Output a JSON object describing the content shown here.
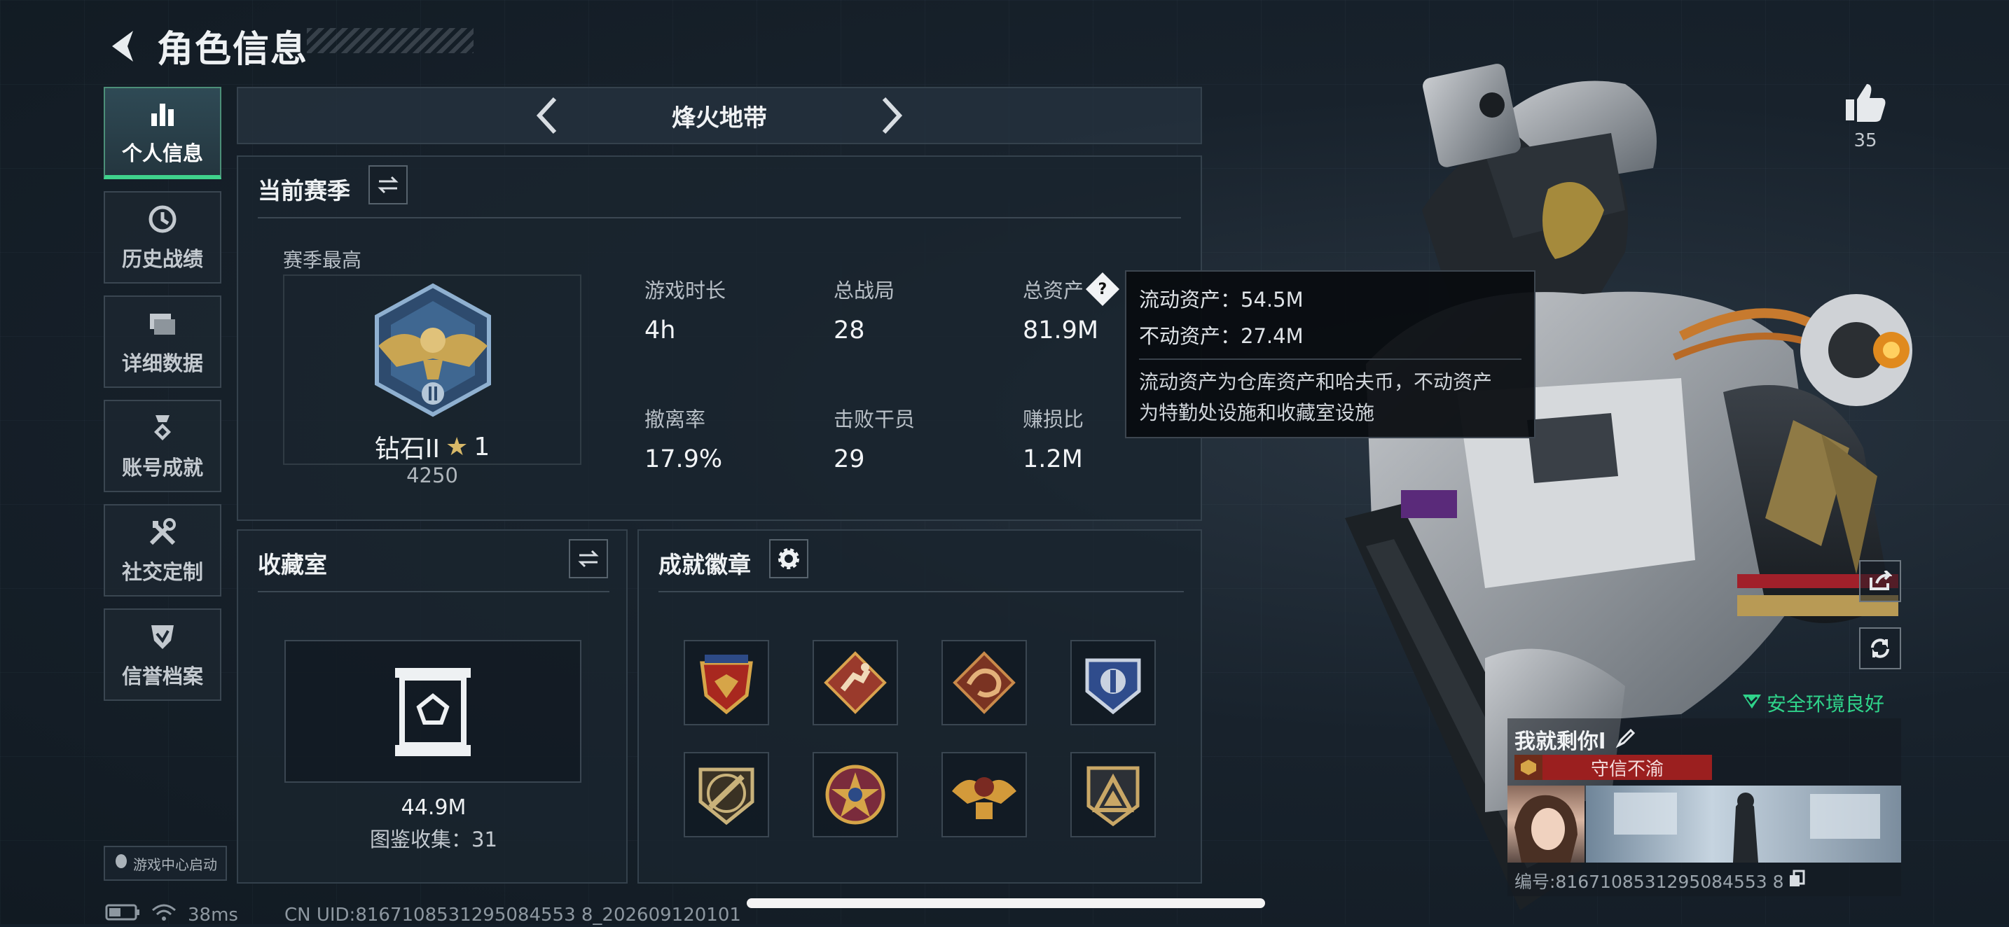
{
  "header": {
    "title": "角色信息"
  },
  "sidebar": {
    "items": [
      {
        "label": "个人信息",
        "icon": "bar-chart-icon",
        "active": true
      },
      {
        "label": "历史战绩",
        "icon": "clock-history-icon",
        "active": false
      },
      {
        "label": "详细数据",
        "icon": "folder-stack-icon",
        "active": false
      },
      {
        "label": "账号成就",
        "icon": "medal-icon",
        "active": false
      },
      {
        "label": "社交定制",
        "icon": "tools-icon",
        "active": false
      },
      {
        "label": "信誉档案",
        "icon": "shield-check-icon",
        "active": false
      }
    ]
  },
  "mode_selector": {
    "title": "烽火地带"
  },
  "season": {
    "title": "当前赛季",
    "best_label": "赛季最高",
    "rank_name": "钻石II",
    "rank_stars": "1",
    "rank_points": "4250",
    "stats": [
      {
        "label": "游戏时长",
        "value": "4h"
      },
      {
        "label": "总战局",
        "value": "28"
      },
      {
        "label": "总资产",
        "value": "81.9M"
      },
      {
        "label": "撤离率",
        "value": "17.9%"
      },
      {
        "label": "击败干员",
        "value": "29"
      },
      {
        "label": "赚损比",
        "value": "1.2M"
      }
    ]
  },
  "tooltip": {
    "liquid": "流动资产：54.5M",
    "fixed": "不动资产：27.4M",
    "desc_line1": "流动资产为仓库资产和哈夫币，不动资产",
    "desc_line2": "为特勤处设施和收藏室设施"
  },
  "collection": {
    "title": "收藏室",
    "value": "44.9M",
    "count_text": "图鉴收集：31"
  },
  "achievements": {
    "title": "成就徽章",
    "badges": [
      "shield-wings-badge",
      "running-figure-badge",
      "dragon-badge",
      "blue-emblem-badge",
      "rifle-badge",
      "star-medal-badge",
      "eagle-badge",
      "triangle-badge"
    ]
  },
  "likes": {
    "count": "35"
  },
  "security": {
    "text": "安全环境良好",
    "color": "#2fd38a"
  },
  "profile": {
    "name": "我就剩你l",
    "title_badge": "守信不渝",
    "id_text": "编号:8167108531295084553 8"
  },
  "footer": {
    "game_center": "游戏中心启动",
    "ping": "38ms",
    "uid": "CN UID:8167108531295084553 8_202609120101"
  },
  "colors": {
    "accent": "#3fd28c",
    "badge_red": "#9b1f1f"
  }
}
